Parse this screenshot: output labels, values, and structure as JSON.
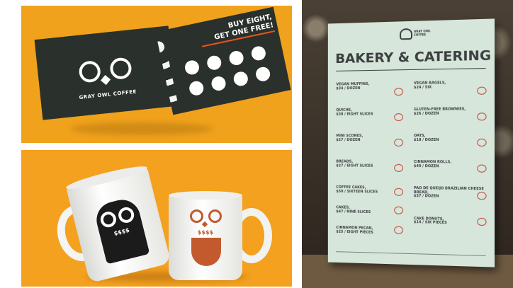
{
  "loyalty_card": {
    "offer_line1": "BUY EIGHT,",
    "offer_line2": "GET ONE FREE!",
    "brand_name": "GRAY OWL COFFEE",
    "stamp_count": 8
  },
  "mugs": {
    "left_mug_mark": "$$$$",
    "right_mug_mark": "$$$$"
  },
  "menu": {
    "title": "BAKERY & CATERING",
    "logo_text": "GRAY OWL COFFEE",
    "left_column": [
      {
        "name": "VEGAN MUFFINS,",
        "price": "$34 / DOZEN"
      },
      {
        "name": "QUICHE,",
        "price": "$38 / EIGHT SLICES"
      },
      {
        "name": "MINI SCONES,",
        "price": "$27 / DOZEN"
      },
      {
        "name": "BREADS,",
        "price": "$27 / EIGHT SLICES"
      },
      {
        "name": "COFFEE CAKES,",
        "price": "$50 / SIXTEEN SLICES"
      },
      {
        "name": "CAKES,",
        "price": "$47 / NINE SLICES"
      },
      {
        "name": "CINNAMON PECAN,",
        "price": "$25 / EIGHT PIECES"
      }
    ],
    "right_column": [
      {
        "name": "VEGAN BAGELS,",
        "price": "$24 / SIX"
      },
      {
        "name": "GLUTEN-FREE BROWNIES,",
        "price": "$26 / DOZEN"
      },
      {
        "name": "OATS,",
        "price": "$18 / DOZEN"
      },
      {
        "name": "CINNAMON ROLLS,",
        "price": "$40 / DOZEN"
      },
      {
        "name": "PAO DE QUEIJO BRAZILIAN CHEESE BREAD,",
        "price": "$37 / DOZEN"
      },
      {
        "name": "CAKE DONUTS,",
        "price": "$14 / SIX PIECES"
      }
    ]
  },
  "colors": {
    "orange": "#f0a21c",
    "card_dark": "#2a302b",
    "menu_paper": "#d6e6da",
    "menu_red": "#c8473a",
    "mug_brown": "#c35a2e"
  }
}
